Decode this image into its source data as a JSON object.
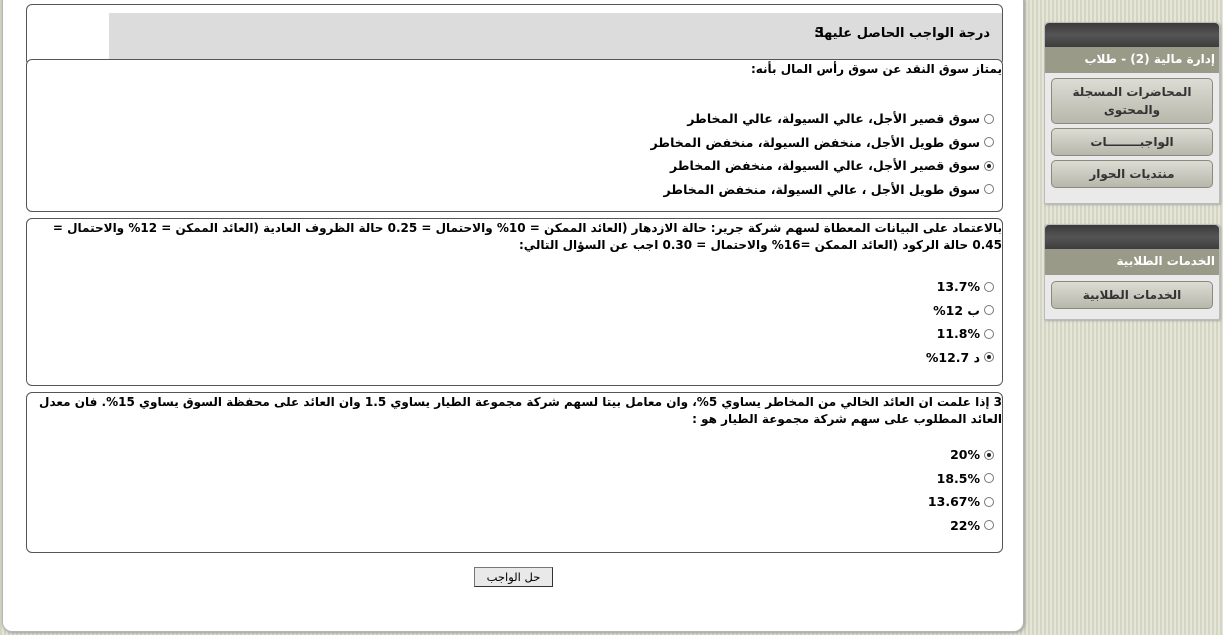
{
  "grade": {
    "label": "درجة الواجب الحاصل عليها:",
    "value": "3"
  },
  "questions": [
    {
      "text": "يمتاز سوق النقد عن سوق رأس المال بأنه:",
      "options": [
        {
          "label": "سوق قصير الأجل، عالي السيولة، عالي المخاطر",
          "checked": false
        },
        {
          "label": "سوق طويل الأجل، منخفض السيولة، منخفض المخاطر",
          "checked": false
        },
        {
          "label": "سوق قصير الأجل، عالي السيولة، منخفض المخاطر",
          "checked": true
        },
        {
          "label": "سوق طويل الأجل ، عالي السيولة، منخفض المخاطر",
          "checked": false
        }
      ]
    },
    {
      "text": "بالاعتماد على البيانات المعطاة لسهم شركة جرير: حالة الازدهار (العائد الممكن = 10% والاحتمال = 0.25 حالة الظروف العادية (العائد الممكن = 12% والاحتمال = 0.45 حالة الركود (العائد الممكن =16% والاحتمال = 0.30 اجب عن السؤال التالي:",
      "options": [
        {
          "label": "13.7%",
          "checked": false
        },
        {
          "label": "ب 12%",
          "checked": false
        },
        {
          "label": "11.8%",
          "checked": false
        },
        {
          "label": "د 12.7%",
          "checked": true
        }
      ]
    },
    {
      "text": "3 إذا علمت ان العائد الخالي من المخاطر يساوي 5%، وان معامل بيتا لسهم شركة مجموعة الطيار يساوي 1.5 وان العائد على محفظة السوق يساوي 15%. فان معدل العائد المطلوب على سهم شركة مجموعة الطيار هو :",
      "options": [
        {
          "label": "20%",
          "checked": true
        },
        {
          "label": "18.5%",
          "checked": false
        },
        {
          "label": "13.67%",
          "checked": false
        },
        {
          "label": "22%",
          "checked": false
        }
      ]
    }
  ],
  "submit_label": "حل الواجب",
  "sidebar": {
    "course_title": "إدارة مالية (2) - طلاب",
    "course_items": [
      "المحاضرات المسجلة والمحتوى",
      "الواجبــــــــات",
      "منتديات الحوار"
    ],
    "services_title": "الخدمات الطلابية",
    "services_items": [
      "الخدمات الطلابية"
    ]
  }
}
